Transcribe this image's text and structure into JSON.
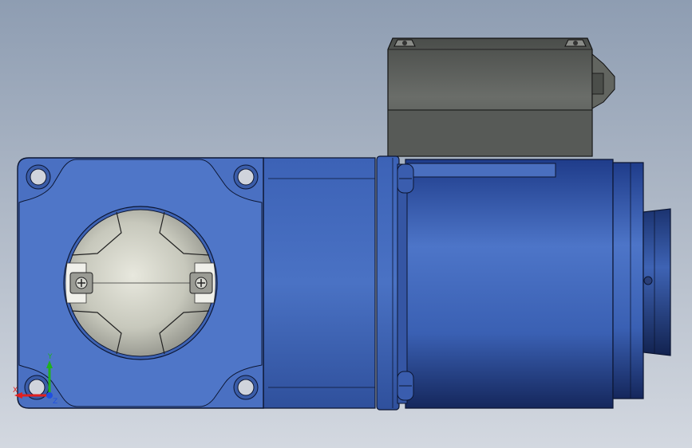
{
  "viewport": {
    "background_top": "#8e9db2",
    "background_bottom": "#d3d8e0"
  },
  "model": {
    "body_color": "#3f63b3",
    "terminal_box_color": "#5a5d5a",
    "end_cap_color": "#c8c8bd",
    "edge_color": "#0f1a33"
  },
  "triad": {
    "x_label": "X",
    "y_label": "Y",
    "z_label": "Z",
    "x_color": "#e02020",
    "y_color": "#20b020",
    "z_color": "#2050e0"
  }
}
